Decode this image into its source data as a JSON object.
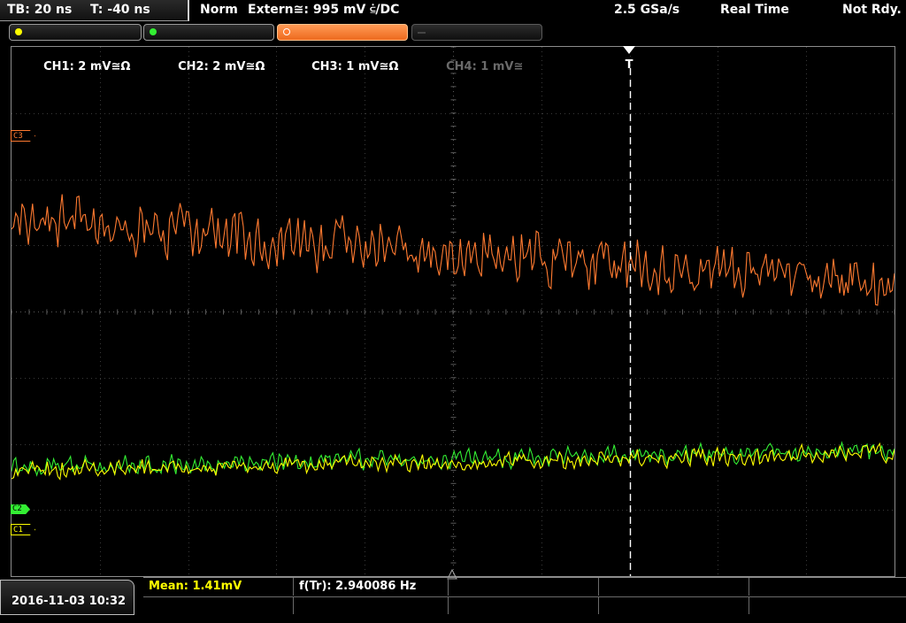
{
  "status_bar": {
    "timebase": "TB: 20 ns",
    "trigger_time": "T: -40 ns",
    "acquisition_mode": "Norm",
    "trigger_source": "Extern≅: 995 mV ⫃/DC",
    "sample_rate": "2.5 GSa/s",
    "time_mode": "Real Time",
    "trigger_status": "Not Rdy."
  },
  "channels": [
    {
      "id": "ch1",
      "label": "CH1: 2 mV≅Ω",
      "color": "#ffff00",
      "state": "on"
    },
    {
      "id": "ch2",
      "label": "CH2: 2 mV≅Ω",
      "color": "#33ee33",
      "state": "on"
    },
    {
      "id": "ch3",
      "label": "CH3: 1 mV≅Ω",
      "color": "#ff7a30",
      "state": "active"
    },
    {
      "id": "ch4",
      "label": "CH4: 1 mV≅",
      "color": "#6a6a6a",
      "state": "off"
    }
  ],
  "markers": {
    "ch3_label": "C3",
    "ch2_label": "C2",
    "ch1_label": "C1",
    "trigger_label": "T"
  },
  "colors": {
    "ch1": "#ffff00",
    "ch2": "#33ee33",
    "ch3": "#ff7a30",
    "grid": "#3a3a3a",
    "grid_center": "#5a5a5a",
    "trigger": "#ffffff"
  },
  "measurements": {
    "mean": "Mean: 1.41mV",
    "frequency": "f(Tr): 2.940086 Hz"
  },
  "datetime": "2016-11-03 10:32",
  "chart_data": {
    "type": "line",
    "title": "",
    "xlabel": "",
    "ylabel": "",
    "grid": true,
    "divisions": {
      "horizontal": 10,
      "vertical": 8
    },
    "trigger_position_div": 7.0,
    "series": [
      {
        "name": "CH3",
        "color": "#ff7a30",
        "baseline_div_start": 2.6,
        "baseline_div_end": 3.6,
        "noise_amplitude_div": 0.55,
        "points": 420
      },
      {
        "name": "CH2",
        "color": "#33ee33",
        "baseline_div_start": 6.35,
        "baseline_div_end": 6.1,
        "noise_amplitude_div": 0.2,
        "points": 420
      },
      {
        "name": "CH1",
        "color": "#ffff00",
        "baseline_div_start": 6.4,
        "baseline_div_end": 6.15,
        "noise_amplitude_div": 0.18,
        "points": 420
      }
    ]
  }
}
